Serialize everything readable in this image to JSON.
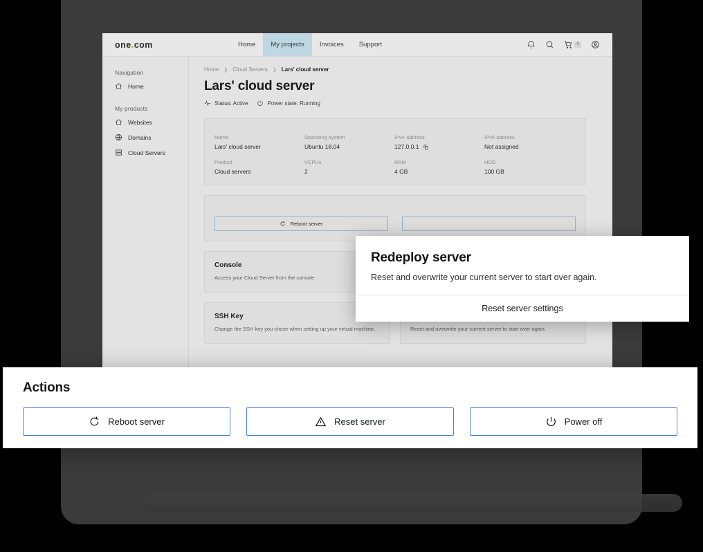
{
  "header": {
    "logo": "one",
    "logo_dot": ".",
    "logo_suffix": "com",
    "nav": [
      {
        "label": "Home",
        "active": false
      },
      {
        "label": "My projects",
        "active": true
      },
      {
        "label": "Invoices",
        "active": false
      },
      {
        "label": "Support",
        "active": false
      }
    ],
    "icons": [
      "bell-icon",
      "search-icon",
      "cart-icon",
      "account-icon"
    ],
    "cart_count": "0"
  },
  "sidebar": {
    "navigation_heading": "Navigation",
    "navigation_items": [
      {
        "label": "Home",
        "icon": "home-icon"
      }
    ],
    "products_heading": "My products",
    "product_items": [
      {
        "label": "Websites",
        "icon": "home-icon"
      },
      {
        "label": "Domains",
        "icon": "globe-icon"
      },
      {
        "label": "Cloud Servers",
        "icon": "server-icon"
      }
    ]
  },
  "main": {
    "breadcrumb": [
      "Home",
      "Cloud Servers",
      "Lars' cloud server"
    ],
    "page_title": "Lars' cloud server",
    "status": "Status: Active",
    "power_state": "Power state: Running",
    "info": [
      {
        "label": "Name",
        "value": "Lars' cloud server"
      },
      {
        "label": "Operating system",
        "value": "Ubuntu 18.04"
      },
      {
        "label": "IPv4 address",
        "value": "127.0.0.1",
        "copy": true
      },
      {
        "label": "IPv6 address",
        "value": "Not assigned"
      },
      {
        "label": "Product",
        "value": "Cloud servers"
      },
      {
        "label": "VCPUs",
        "value": "2"
      },
      {
        "label": "RAM",
        "value": "4 GB"
      },
      {
        "label": "HDD",
        "value": "100 GB"
      }
    ],
    "page_buttons": [
      {
        "label": "Reboot server",
        "icon": "reboot-icon"
      },
      {
        "label": "",
        "icon": ""
      }
    ],
    "feature_cards": [
      {
        "title": "Console",
        "desc": "Access your Cloud Server from the console."
      },
      {
        "title": "",
        "desc": ""
      },
      {
        "title": "SSH Key",
        "desc": "Change the SSH key you chose when setting up your virtual machine."
      },
      {
        "title": "Redeploy server",
        "desc": "Reset and overwrite your current server to start over again."
      }
    ]
  },
  "modal": {
    "title": "Redeploy server",
    "description": "Reset and overwrite your current server to start over again.",
    "action_label": "Reset server settings"
  },
  "actions_overlay": {
    "heading": "Actions",
    "buttons": [
      {
        "label": "Reboot server",
        "icon": "reboot-icon"
      },
      {
        "label": "Reset server",
        "icon": "warning-triangle-icon"
      },
      {
        "label": "Power off",
        "icon": "power-icon"
      }
    ]
  },
  "colors": {
    "accent_blue": "#4a7fe0",
    "nav_active": "#bdd7e3",
    "page_bg": "#e3e3e3",
    "frame": "#3b3b3b"
  }
}
